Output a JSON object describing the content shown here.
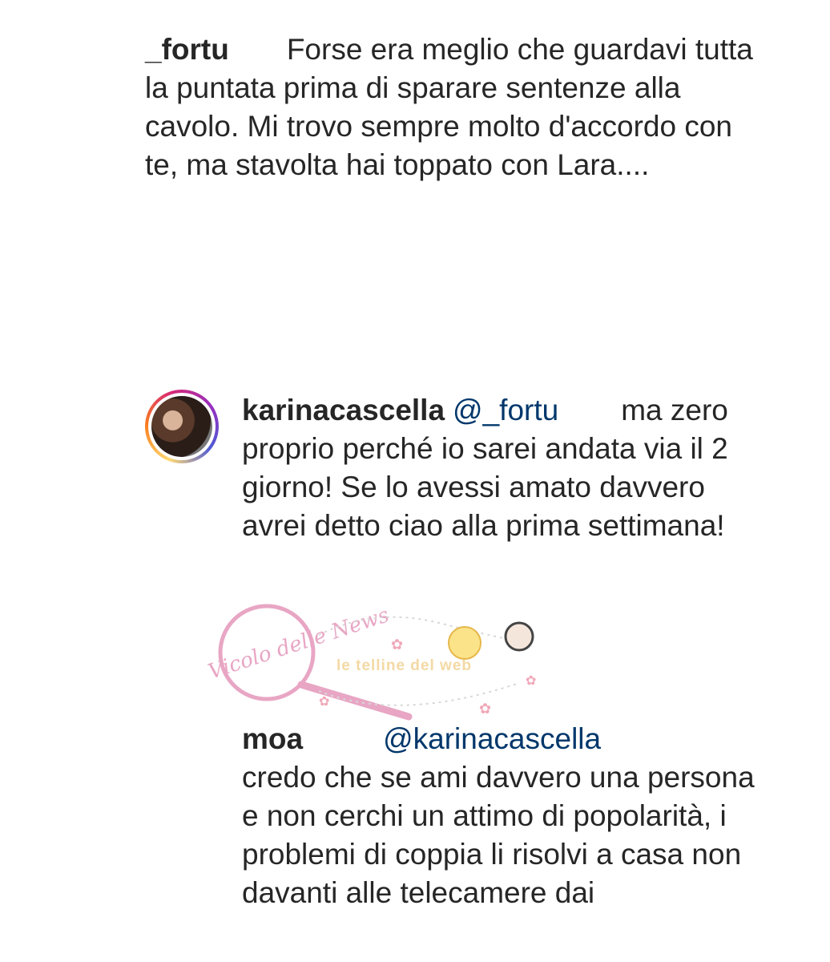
{
  "comments": [
    {
      "username": "_fortu",
      "mention": "",
      "text": "Forse era meglio che guardavi tutta la puntata prima di sparare sentenze alla cavolo. Mi trovo sempre molto d'accordo con te, ma stavolta hai toppato con Lara...."
    },
    {
      "username": "karinacascella",
      "mention": "@_fortu",
      "text": "ma zero proprio perché io sarei andata via il 2 giorno! Se lo avessi amato davvero avrei detto ciao alla prima settimana!"
    },
    {
      "username": "moa",
      "mention": "@karinacascella",
      "text": "credo che se ami davvero una persona e non cerchi un attimo di popolarità, i problemi di coppia li risolvi a casa non davanti alle telecamere dai"
    }
  ],
  "watermark": {
    "logo_text": "Vicolo delle News",
    "tagline": "le telline del web"
  },
  "colors": {
    "text": "#262626",
    "mention": "#00376b",
    "watermark_pink": "#e8a6c4"
  }
}
